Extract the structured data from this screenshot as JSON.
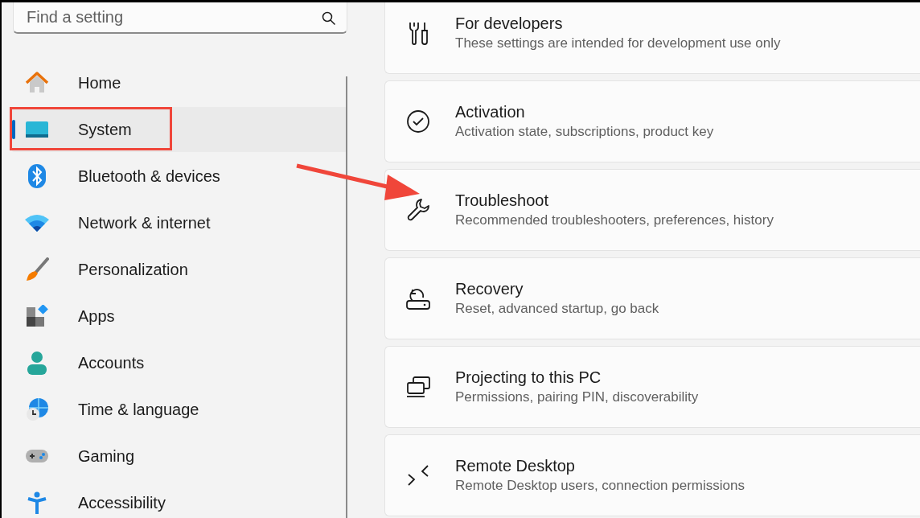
{
  "search": {
    "placeholder": "Find a setting"
  },
  "sidebar": {
    "items": [
      {
        "label": "Home",
        "selected": false,
        "highlighted": false
      },
      {
        "label": "System",
        "selected": true,
        "highlighted": true
      },
      {
        "label": "Bluetooth & devices",
        "selected": false,
        "highlighted": false
      },
      {
        "label": "Network & internet",
        "selected": false,
        "highlighted": false
      },
      {
        "label": "Personalization",
        "selected": false,
        "highlighted": false
      },
      {
        "label": "Apps",
        "selected": false,
        "highlighted": false
      },
      {
        "label": "Accounts",
        "selected": false,
        "highlighted": false
      },
      {
        "label": "Time & language",
        "selected": false,
        "highlighted": false
      },
      {
        "label": "Gaming",
        "selected": false,
        "highlighted": false
      },
      {
        "label": "Accessibility",
        "selected": false,
        "highlighted": false
      }
    ]
  },
  "settings": [
    {
      "title": "For developers",
      "description": "These settings are intended for development use only"
    },
    {
      "title": "Activation",
      "description": "Activation state, subscriptions, product key"
    },
    {
      "title": "Troubleshoot",
      "description": "Recommended troubleshooters, preferences, history"
    },
    {
      "title": "Recovery",
      "description": "Reset, advanced startup, go back"
    },
    {
      "title": "Projecting to this PC",
      "description": "Permissions, pairing PIN, discoverability"
    },
    {
      "title": "Remote Desktop",
      "description": "Remote Desktop users, connection permissions"
    }
  ]
}
